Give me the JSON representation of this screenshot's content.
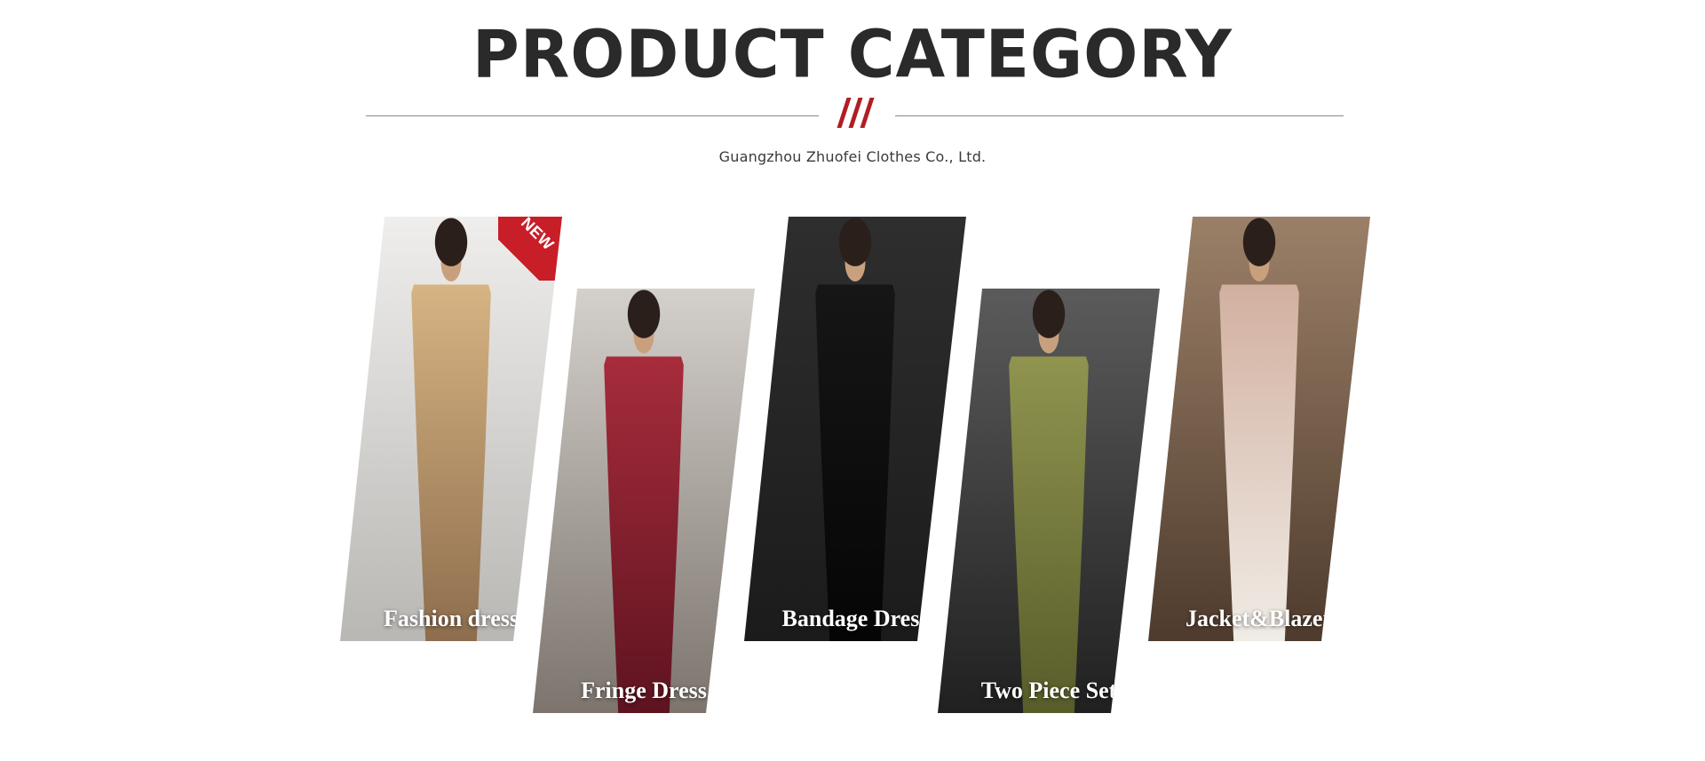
{
  "header": {
    "title": "PRODUCT CATEGORY",
    "divider_mark": "///",
    "subtitle": "Guangzhou Zhuofei Clothes Co., Ltd."
  },
  "categories": [
    {
      "label": "Fashion dress",
      "badge": "NEW",
      "bg_colors": [
        "#f0eeec",
        "#b9b7b4"
      ],
      "figure_colors": [
        "#d7b483",
        "#8d6d4d"
      ]
    },
    {
      "label": "Fringe Dress",
      "bg_colors": [
        "#d4d0cb",
        "#7c746d"
      ],
      "figure_colors": [
        "#a72c3b",
        "#5e1320"
      ]
    },
    {
      "label": "Bandage Dress",
      "bg_colors": [
        "#2e2e2e",
        "#1b1b1b"
      ],
      "figure_colors": [
        "#161616",
        "#050505"
      ]
    },
    {
      "label": "Two Piece Set",
      "bg_colors": [
        "#5b5b5b",
        "#202020"
      ],
      "figure_colors": [
        "#90944f",
        "#575c2a"
      ]
    },
    {
      "label": "Jacket&Blazer",
      "bg_colors": [
        "#9b8068",
        "#4e3b2d"
      ],
      "figure_colors": [
        "#d2b0a0",
        "#f0ece6"
      ]
    }
  ],
  "colors": {
    "title": "#2a2a2a",
    "accent": "#b01e24",
    "rule": "#8a8a8a",
    "subtitle": "#3a3a3a"
  }
}
